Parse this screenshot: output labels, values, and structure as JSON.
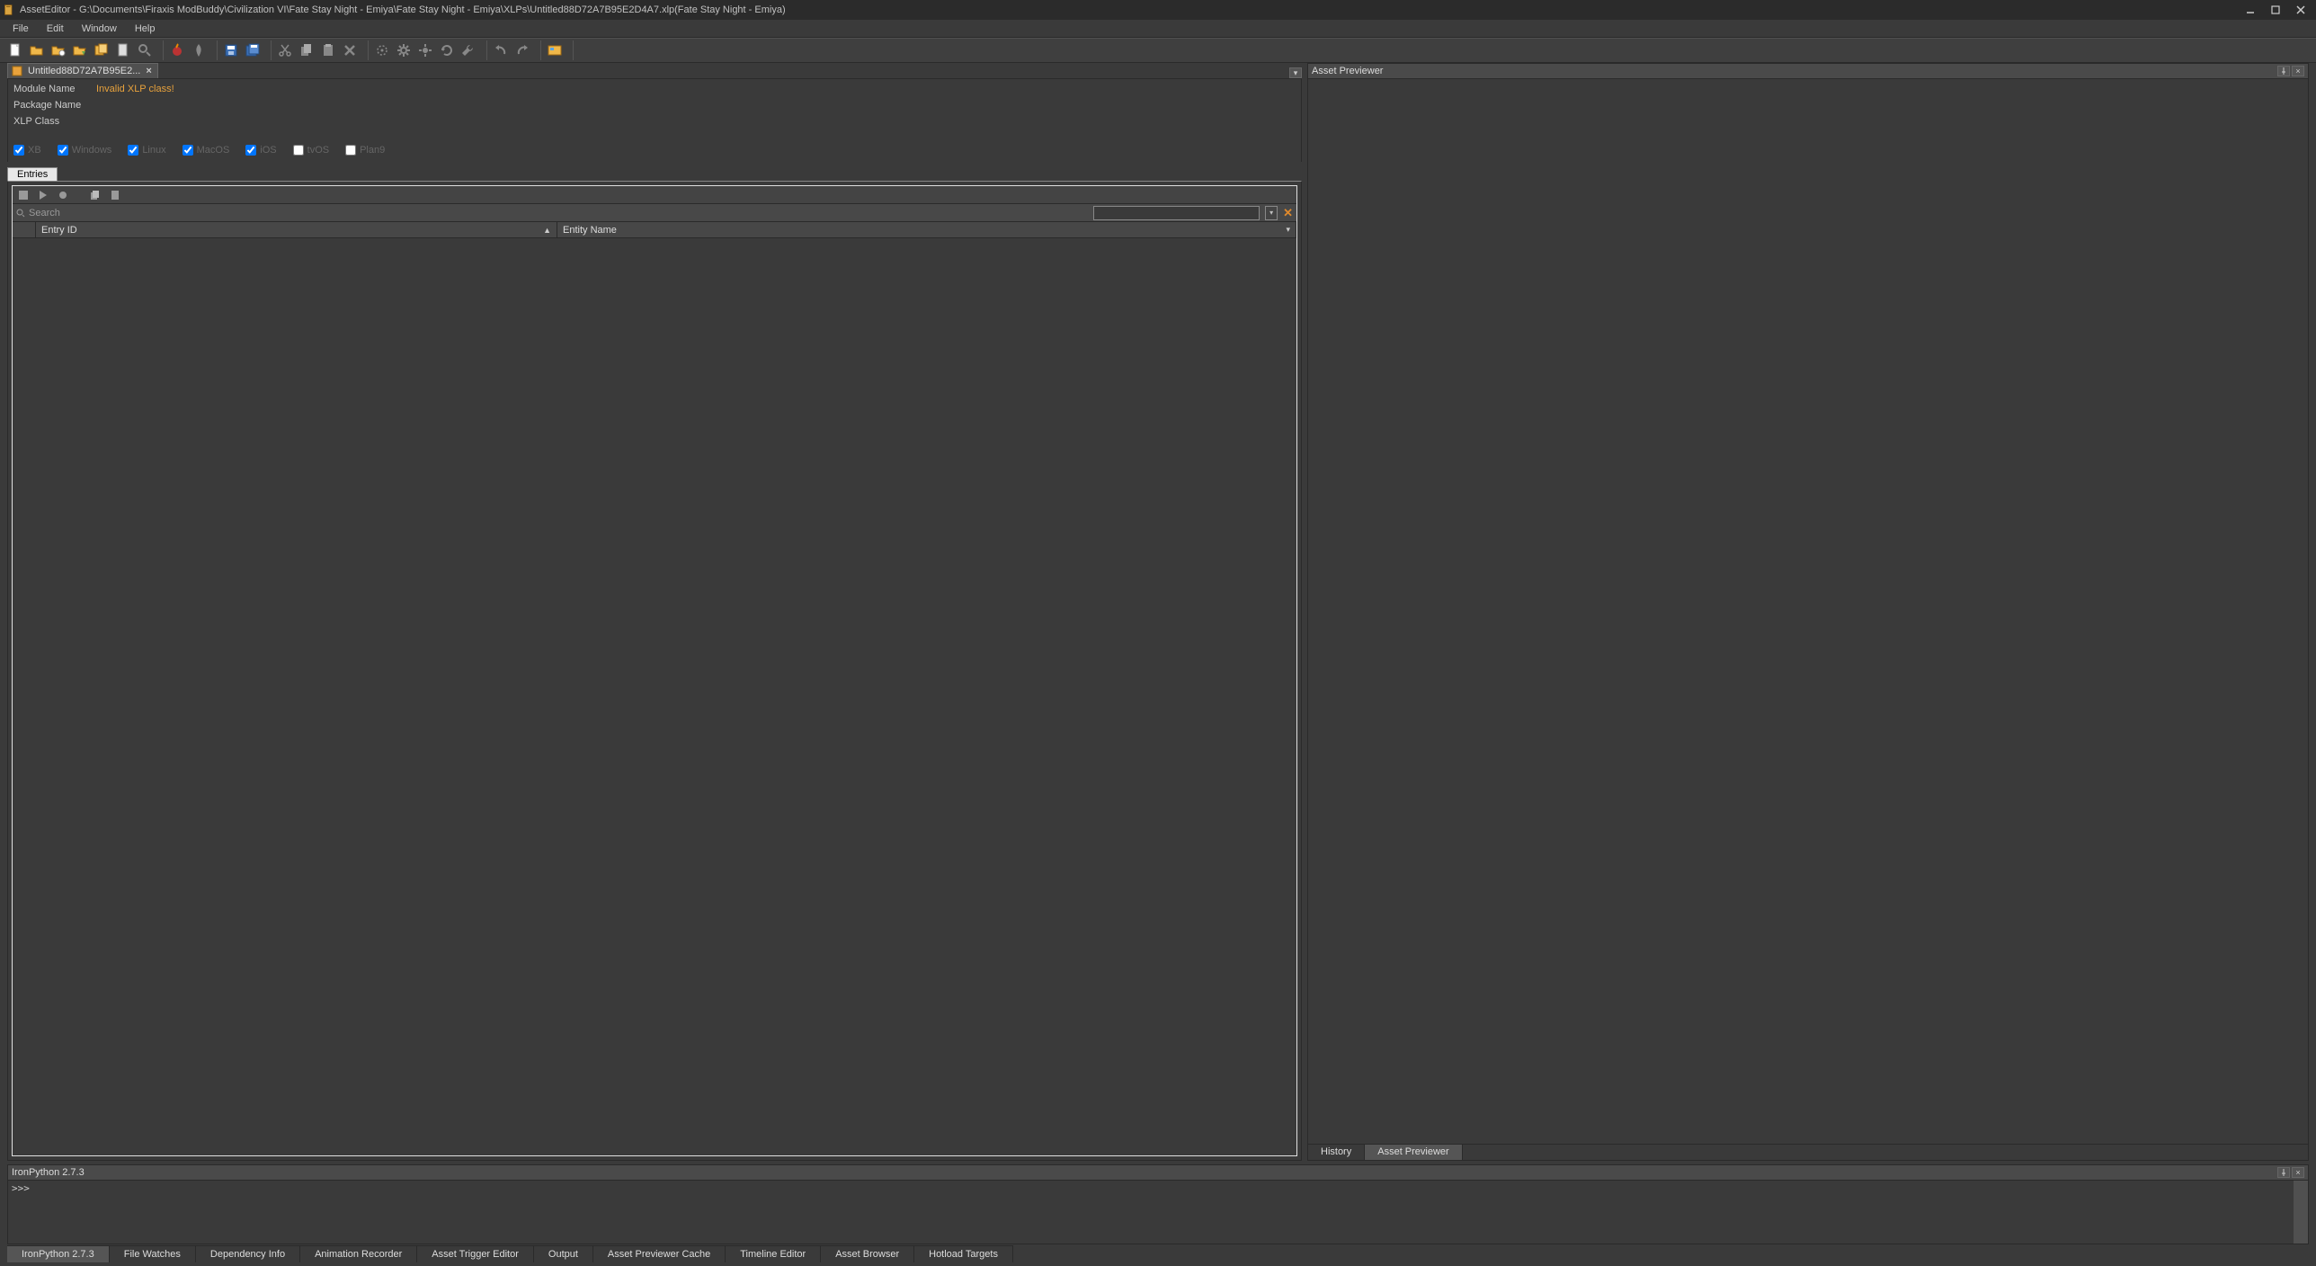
{
  "titlebar": {
    "title": "AssetEditor - G:\\Documents\\Firaxis ModBuddy\\Civilization VI\\Fate Stay Night - Emiya\\Fate Stay Night - Emiya\\XLPs\\Untitled88D72A7B95E2D4A7.xlp(Fate Stay Night - Emiya)"
  },
  "menubar": {
    "file": "File",
    "edit": "Edit",
    "window": "Window",
    "help": "Help"
  },
  "doc": {
    "tab_label": "Untitled88D72A7B95E2...",
    "module_name_label": "Module Name",
    "module_name_value": "Invalid XLP class!",
    "package_name_label": "Package Name",
    "xlp_class_label": "XLP Class"
  },
  "platforms": {
    "xb": "XB",
    "windows": "Windows",
    "linux": "Linux",
    "macos": "MacOS",
    "ios": "iOS",
    "tvos": "tvOS",
    "plan9": "Plan9"
  },
  "entries": {
    "tab_label": "Entries",
    "search_label": "Search",
    "col_entry_id": "Entry ID",
    "col_entity_name": "Entity Name"
  },
  "asset_previewer": {
    "title": "Asset Previewer",
    "tab_history": "History",
    "tab_previewer": "Asset Previewer"
  },
  "console": {
    "title": "IronPython 2.7.3",
    "prompt": ">>>"
  },
  "bottom_tabs": {
    "ironpython": "IronPython 2.7.3",
    "file_watches": "File Watches",
    "dependency_info": "Dependency Info",
    "animation_recorder": "Animation Recorder",
    "asset_trigger_editor": "Asset Trigger Editor",
    "output": "Output",
    "asset_previewer_cache": "Asset Previewer Cache",
    "timeline_editor": "Timeline Editor",
    "asset_browser": "Asset Browser",
    "hotload_targets": "Hotload Targets"
  }
}
